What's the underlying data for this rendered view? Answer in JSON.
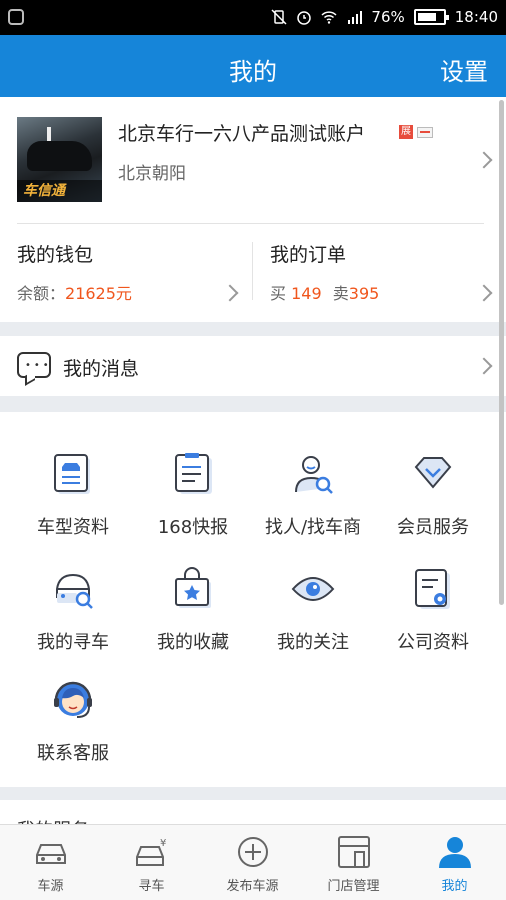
{
  "status_bar": {
    "battery": "76%",
    "battery_level": 0.76,
    "time": "18:40"
  },
  "header": {
    "title": "我的",
    "settings_label": "设置"
  },
  "profile": {
    "name": "北京车行一六八产品测试账户",
    "badge_zhan": "展",
    "location": "北京朝阳",
    "avatar_tag": "车信通",
    "verified_badge": "V"
  },
  "wallet": {
    "title": "我的钱包",
    "balance_label": "余额：",
    "balance_value": "21625元"
  },
  "orders": {
    "title": "我的订单",
    "buy_label": "买",
    "buy_count": "149",
    "sell_label": "卖",
    "sell_count": "395"
  },
  "messages": {
    "label": "我的消息"
  },
  "grid": {
    "items": [
      {
        "label": "车型资料",
        "icon": "car-document-icon"
      },
      {
        "label": "168快报",
        "icon": "news-icon"
      },
      {
        "label": "找人/找车商",
        "icon": "person-search-icon"
      },
      {
        "label": "会员服务",
        "icon": "diamond-icon"
      },
      {
        "label": "我的寻车",
        "icon": "car-search-icon"
      },
      {
        "label": "我的收藏",
        "icon": "favorites-bag-icon"
      },
      {
        "label": "我的关注",
        "icon": "eye-icon"
      },
      {
        "label": "公司资料",
        "icon": "certificate-icon"
      },
      {
        "label": "联系客服",
        "icon": "customer-service-icon"
      }
    ]
  },
  "next_section_peek": "我的服务",
  "tabs": [
    {
      "label": "车源",
      "icon": "car-icon"
    },
    {
      "label": "寻车",
      "icon": "car-yen-icon"
    },
    {
      "label": "发布车源",
      "icon": "plus-circle-icon"
    },
    {
      "label": "门店管理",
      "icon": "store-icon"
    },
    {
      "label": "我的",
      "icon": "user-icon",
      "active": true
    }
  ],
  "colors": {
    "brand": "#1685d9",
    "accent": "#f0561d",
    "icon_blue": "#3b7de0"
  }
}
